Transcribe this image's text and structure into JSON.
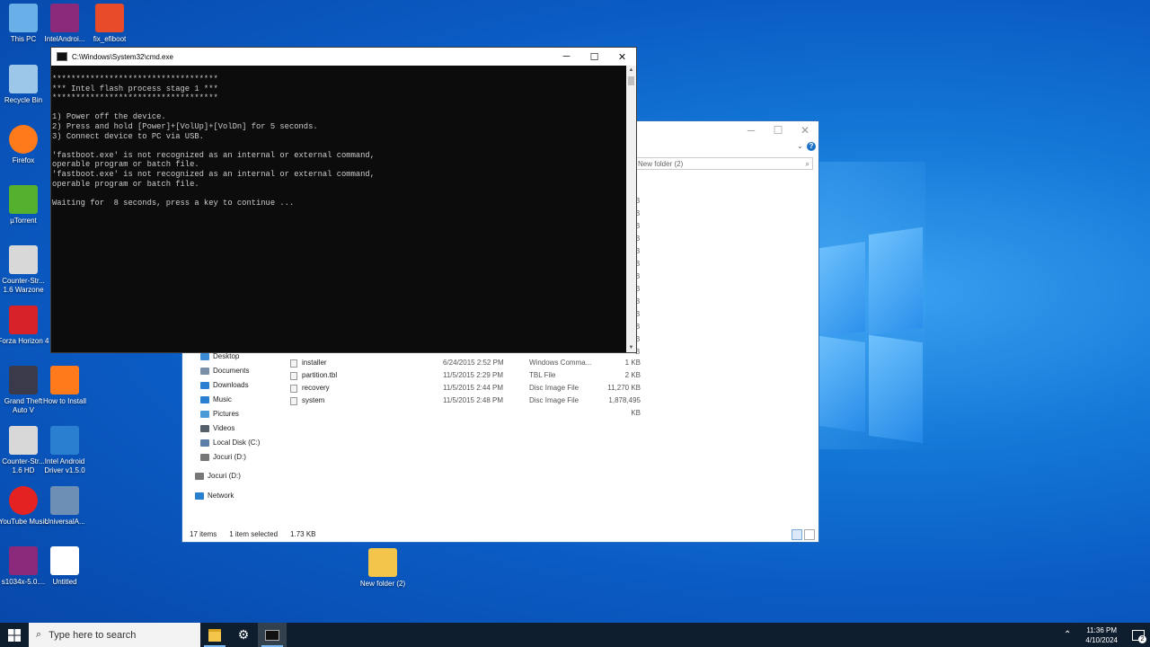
{
  "desktop": {
    "icons": [
      {
        "label": "This PC",
        "icon": "this-pc-icon",
        "color": "#6ab0e8"
      },
      {
        "label": "IntelAndroi...",
        "icon": "winrar-icon",
        "color": "#8b2a7a"
      },
      {
        "label": "fix_efiboot",
        "icon": "efiboot-icon",
        "color": "#e84b2a"
      },
      {
        "label": "Recycle Bin",
        "icon": "recycle-bin-icon",
        "color": "#9cc7e8"
      },
      {
        "label": "Firefox",
        "icon": "firefox-icon",
        "color": "#ff7a1a"
      },
      {
        "label": "µTorrent",
        "icon": "utorrent-icon",
        "color": "#55b02e"
      },
      {
        "label": "Counter-Str... 1.6 Warzone",
        "icon": "counter-strike-icon",
        "color": "#d8d8d8"
      },
      {
        "label": "Forza Horizon 4",
        "icon": "forza-icon",
        "color": "#d8222a"
      },
      {
        "label": "Grand Theft Auto V",
        "icon": "gta-icon",
        "color": "#3a3a4a"
      },
      {
        "label": "How to Install",
        "icon": "firefox-doc-icon",
        "color": "#ff7a1a"
      },
      {
        "label": "Counter-Str... 1.6 HD",
        "icon": "counter-strike-icon",
        "color": "#d8d8d8"
      },
      {
        "label": "Intel Android Driver v1.5.0",
        "icon": "intel-driver-icon",
        "color": "#2a7fd0"
      },
      {
        "label": "YouTube Music",
        "icon": "youtube-music-icon",
        "color": "#e52222"
      },
      {
        "label": "UniversalA...",
        "icon": "universal-adb-icon",
        "color": "#6e8fb5"
      },
      {
        "label": "s1034x-5.0....",
        "icon": "winrar-icon",
        "color": "#8b2a7a"
      },
      {
        "label": "Untitled",
        "icon": "image-file-icon",
        "color": "#ffffff"
      },
      {
        "label": "New folder (2)",
        "icon": "folder-icon",
        "color": "#f3c64b"
      }
    ]
  },
  "cmd": {
    "title": "C:\\Windows\\System32\\cmd.exe",
    "output": "***********************************\n*** Intel flash process stage 1 ***\n***********************************\n\n1) Power off the device.\n2) Press and hold [Power]+[VolUp]+[VolDn] for 5 seconds.\n3) Connect device to PC via USB.\n\n'fastboot.exe' is not recognized as an internal or external command,\noperable program or batch file.\n'fastboot.exe' is not recognized as an internal or external command,\noperable program or batch file.\n\nWaiting for  8 seconds, press a key to continue ...",
    "minimize": "─",
    "maximize": "☐",
    "close": "✕"
  },
  "explorer": {
    "search_placeholder": "New folder (2)",
    "size_fragments": [
      "B",
      "B",
      "B",
      "B",
      "B",
      "B",
      "B",
      "B",
      "B",
      "B",
      "B",
      "B",
      "B"
    ],
    "nav": [
      {
        "label": "Desktop",
        "icon": "desktop-icon",
        "color": "#3b8bd6"
      },
      {
        "label": "Documents",
        "icon": "documents-icon",
        "color": "#7a8fa8"
      },
      {
        "label": "Downloads",
        "icon": "downloads-icon",
        "color": "#2a7fd0"
      },
      {
        "label": "Music",
        "icon": "music-icon",
        "color": "#2a7fd0"
      },
      {
        "label": "Pictures",
        "icon": "pictures-icon",
        "color": "#4a9ad8"
      },
      {
        "label": "Videos",
        "icon": "videos-icon",
        "color": "#555f6a"
      },
      {
        "label": "Local Disk (C:)",
        "icon": "local-disk-icon",
        "color": "#5a7ea8"
      },
      {
        "label": "Jocuri (D:)",
        "icon": "drive-icon",
        "color": "#777"
      },
      {
        "label": "Jocuri (D:)",
        "icon": "drive-icon",
        "color": "#777"
      },
      {
        "label": "Network",
        "icon": "network-icon",
        "color": "#2a7fd0"
      }
    ],
    "files": [
      {
        "name": "installer",
        "date": "6/24/2015 2:52 PM",
        "type": "Windows Comma...",
        "size": "1 KB"
      },
      {
        "name": "partition.tbl",
        "date": "11/5/2015 2:29 PM",
        "type": "TBL File",
        "size": "2 KB"
      },
      {
        "name": "recovery",
        "date": "11/5/2015 2:44 PM",
        "type": "Disc Image File",
        "size": "11,270 KB"
      },
      {
        "name": "system",
        "date": "11/5/2015 2:48 PM",
        "type": "Disc Image File",
        "size": "1,878,495 KB"
      }
    ],
    "status": {
      "items": "17 items",
      "selected": "1 item selected",
      "size": "1.73 KB"
    }
  },
  "taskbar": {
    "search_placeholder": "Type here to search",
    "time": "11:36 PM",
    "date": "4/10/2024",
    "notification_count": "2"
  }
}
